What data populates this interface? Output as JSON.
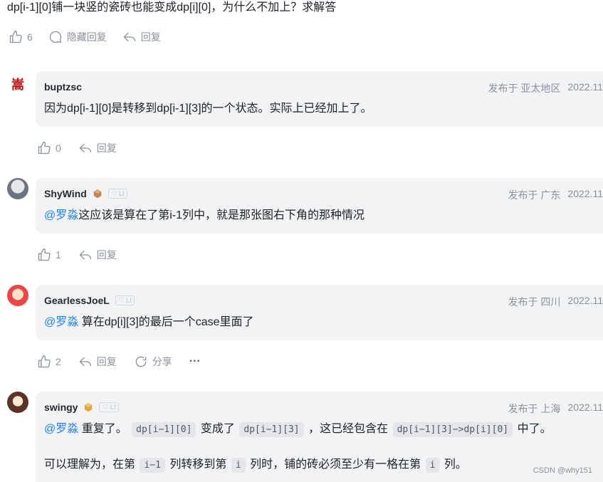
{
  "question": "dp[i-1][0]铺一块竖的瓷砖也能变成dp[i][0]，为什么不加上？求解答",
  "top_actions": {
    "like_count": "6",
    "hide_reply_label": "隐藏回复",
    "reply_label": "回复"
  },
  "comments": [
    {
      "username": "buptzsc",
      "avatar_glyph": "嵩",
      "location": "发布于 亚太地区",
      "date": "2022.11",
      "content": "因为dp[i-1][0]是转移到dp[i-1][3]的一个状态。实际上已经加上了。",
      "like_count": "0",
      "reply_label": "回复"
    },
    {
      "username": "ShyWind",
      "level": "Lt",
      "location": "发布于 广东",
      "date": "2022.11",
      "mention": "@罗淼",
      "content": "这应该是算在了第i-1列中，就是那张图右下角的那种情况",
      "like_count": "1",
      "reply_label": "回复"
    },
    {
      "username": "GearlessJoeL",
      "level": "Lt",
      "location": "发布于 四川",
      "date": "2022.11",
      "mention": "@罗淼",
      "content": " 算在dp[i][3]的最后一个case里面了",
      "like_count": "2",
      "reply_label": "回复",
      "share_label": "分享",
      "more_label": "···"
    },
    {
      "username": "swingy",
      "level": "Lt",
      "location": "发布于 上海",
      "date": "2022.11",
      "mention": "@罗淼",
      "text1": " 重复了。",
      "code1": "dp[i−1][0]",
      "text2": "变成了",
      "code2": "dp[i−1][3]",
      "text3": "，这已经包含在",
      "code3": "dp[i−1][3]−>dp[i][0]",
      "text4": "中了。",
      "line2_text1": "可以理解为，在第",
      "line2_code1": "i−1",
      "line2_text2": "列转移到第",
      "line2_code2": "i",
      "line2_text3": "列时，铺的砖必须至少有一格在第",
      "line2_code3": "i",
      "line2_text4": "列。"
    }
  ],
  "watermark": "CSDN @why151",
  "colors": {
    "accent": "#1e80ff",
    "bubble": "#f2f3f5",
    "muted": "#8a919f"
  },
  "icons": [
    "thumbs-up-icon",
    "comment-icon",
    "reply-icon",
    "share-icon",
    "more-icon",
    "level-badge-icon",
    "cube-badge-icon"
  ]
}
